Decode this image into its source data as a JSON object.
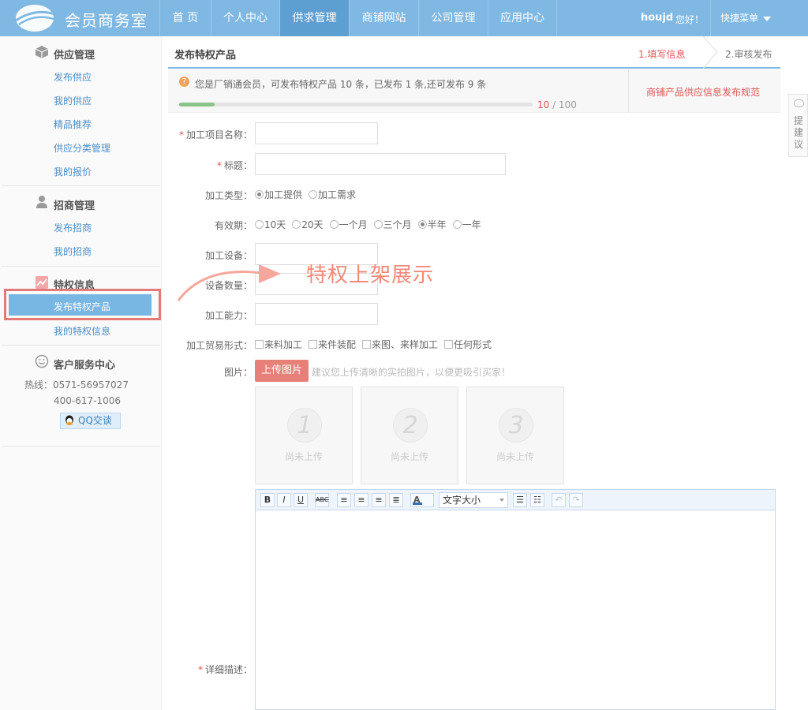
{
  "header": {
    "app_title": "会员商务室",
    "nav": [
      "首 页",
      "个人中心",
      "供求管理",
      "商铺网站",
      "公司管理",
      "应用中心"
    ],
    "active_nav": "供求管理",
    "user": "houjd",
    "greeting": "您好！",
    "quick_menu": "快捷菜单"
  },
  "sidebar": {
    "supply": {
      "title": "供应管理",
      "items": [
        "发布供应",
        "我的供应",
        "精品推荐",
        "供应分类管理",
        "我的报价"
      ]
    },
    "invest": {
      "title": "招商管理",
      "items": [
        "发布招商",
        "我的招商"
      ]
    },
    "privilege": {
      "title": "特权信息",
      "items": [
        "发布特权产品",
        "我的特权信息"
      ],
      "active": "发布特权产品"
    },
    "service": {
      "title": "客户服务中心",
      "hotline_label": "热线：",
      "phone1": "0571-56957027",
      "phone2": "400-617-1006",
      "qq_label": "QQ交谈"
    }
  },
  "page": {
    "title": "发布特权产品",
    "steps": [
      "1.填写信息",
      "2.审核发布"
    ],
    "active_step": 1
  },
  "notice": {
    "text": "您是厂销通会员，可发布特权产品 10 条，已发布 1 条,还可发布 9 条",
    "progress": {
      "current": "10",
      "sep": " / ",
      "max": "100",
      "fraction": 0.1
    },
    "rule_link": "商铺产品供应信息发布规范"
  },
  "form": {
    "name_label": "加工项目名称：",
    "title_label": "标题：",
    "type_label": "加工类型：",
    "type_options": [
      "加工提供",
      "加工需求"
    ],
    "type_selected": "加工提供",
    "validity_label": "有效期：",
    "validity_options": [
      "10天",
      "20天",
      "一个月",
      "三个月",
      "半年",
      "一年"
    ],
    "validity_selected": "半年",
    "equip_label": "加工设备：",
    "equip_qty_label": "设备数量：",
    "capacity_label": "加工能力：",
    "trade_label": "加工贸易形式：",
    "trade_options": [
      "来料加工",
      "来件装配",
      "来图、来样加工",
      "任何形式"
    ],
    "image_label": "图片：",
    "upload_button": "上传图片",
    "upload_hint": "建议您上传清晰的实拍图片，以便更吸引买家！",
    "slots": [
      {
        "num": "1",
        "status": "尚未上传"
      },
      {
        "num": "2",
        "status": "尚未上传"
      },
      {
        "num": "3",
        "status": "尚未上传"
      }
    ],
    "desc_label": "详细描述：",
    "editor": {
      "fontsize": "文字大小"
    }
  },
  "promo": "特权上架展示",
  "feedback": "提建议",
  "colors": {
    "topbar": "#7fb8e2",
    "active_nav": "#5e9fd2",
    "accent_red": "#e05656",
    "highlight": "#78b6e4"
  }
}
